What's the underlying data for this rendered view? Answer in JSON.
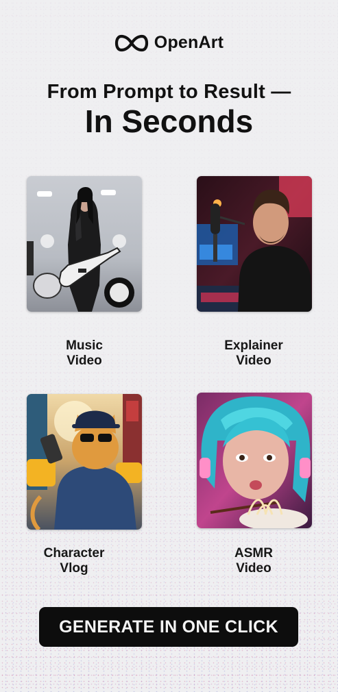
{
  "brand": {
    "name": "OpenArt",
    "logo_icon": "infinity-icon"
  },
  "headline": {
    "line1": "From Prompt to Result —",
    "line2": "In Seconds"
  },
  "cards": [
    {
      "line1": "Music",
      "line2": "Video",
      "image": "rock-guitarist-photo"
    },
    {
      "line1": "Explainer",
      "line2": "Video",
      "image": "podcaster-microphone-photo"
    },
    {
      "line1": "Character",
      "line2": "Vlog",
      "image": "cat-selfie-city-photo"
    },
    {
      "line1": "ASMR",
      "line2": "Video",
      "image": "woman-eating-noodles-photo"
    }
  ],
  "cta": {
    "label": "GENERATE IN ONE CLICK"
  },
  "colors": {
    "background": "#efeff1",
    "button": "#0d0d0d",
    "button_text": "#f4f4f4"
  }
}
